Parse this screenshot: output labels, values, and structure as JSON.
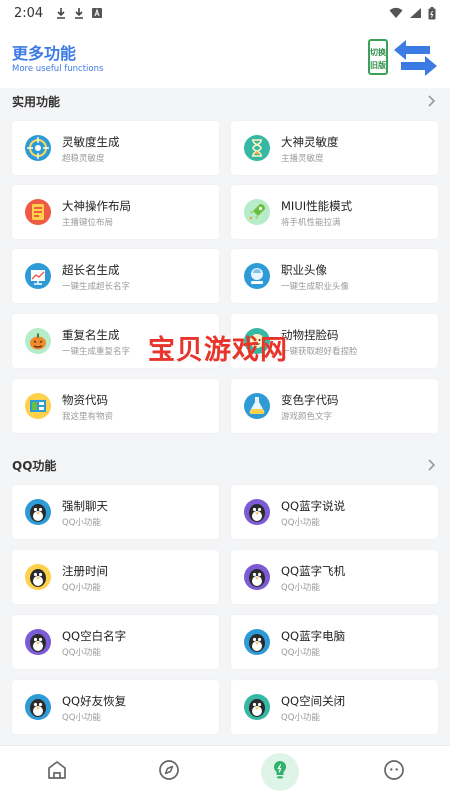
{
  "status_bar": {
    "time": "2:04",
    "left_icons": [
      "download-icon",
      "download-icon",
      "app-notification-icon"
    ],
    "right_icons": [
      "wifi-icon",
      "signal-icon",
      "battery-icon"
    ]
  },
  "header": {
    "title": "更多功能",
    "subtitle": "More useful functions",
    "logo_text": [
      "切换",
      "旧版"
    ],
    "accent": "#3d7be4"
  },
  "sections": [
    {
      "title": "实用功能",
      "items": [
        {
          "title": "灵敏度生成",
          "sub": "超稳灵敏度",
          "icon": "target-icon"
        },
        {
          "title": "大神灵敏度",
          "sub": "主播灵敏度",
          "icon": "hourglass-icon"
        },
        {
          "title": "大神操作布局",
          "sub": "主播键位布局",
          "icon": "layout-icon"
        },
        {
          "title": "MIUI性能模式",
          "sub": "将手机性能拉满",
          "icon": "rocket-icon"
        },
        {
          "title": "超长名生成",
          "sub": "一键生成超长名字",
          "icon": "chart-icon"
        },
        {
          "title": "职业头像",
          "sub": "一键生成职业头像",
          "icon": "portrait-icon"
        },
        {
          "title": "重复名生成",
          "sub": "一键生成重复名字",
          "icon": "pumpkin-icon"
        },
        {
          "title": "动物捏脸码",
          "sub": "一键获取超好看捏脸",
          "icon": "face-icon"
        },
        {
          "title": "物资代码",
          "sub": "我这里有物资",
          "icon": "supplies-icon"
        },
        {
          "title": "变色字代码",
          "sub": "游戏颜色文字",
          "icon": "potion-icon"
        }
      ]
    },
    {
      "title": "QQ功能",
      "items": [
        {
          "title": "强制聊天",
          "sub": "QQ小功能",
          "icon": "qq-penguin-icon"
        },
        {
          "title": "QQ蓝字说说",
          "sub": "QQ小功能",
          "icon": "qq-penguin-icon"
        },
        {
          "title": "注册时间",
          "sub": "QQ小功能",
          "icon": "qq-penguin-icon"
        },
        {
          "title": "QQ蓝字飞机",
          "sub": "QQ小功能",
          "icon": "qq-penguin-icon"
        },
        {
          "title": "QQ空白名字",
          "sub": "QQ小功能",
          "icon": "qq-penguin-icon"
        },
        {
          "title": "QQ蓝字电脑",
          "sub": "QQ小功能",
          "icon": "qq-penguin-icon"
        },
        {
          "title": "QQ好友恢复",
          "sub": "QQ小功能",
          "icon": "qq-penguin-icon"
        },
        {
          "title": "QQ空间关闭",
          "sub": "QQ小功能",
          "icon": "qq-penguin-icon"
        }
      ]
    }
  ],
  "watermark": "宝贝游戏网",
  "bottom_nav": [
    {
      "name": "home-icon",
      "active": false
    },
    {
      "name": "compass-icon",
      "active": false
    },
    {
      "name": "lightbulb-icon",
      "active": true
    },
    {
      "name": "chat-icon",
      "active": false
    }
  ],
  "colors": {
    "active_nav": "#2fb36a",
    "nav_inactive": "#666666"
  }
}
